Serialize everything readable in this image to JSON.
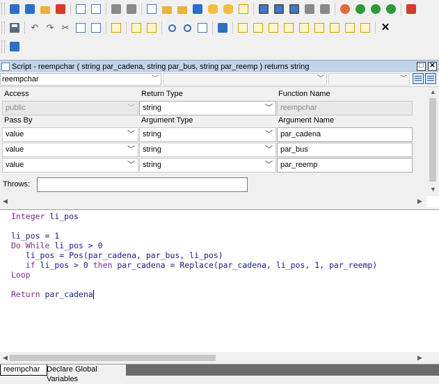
{
  "toolbar3": {
    "icon": "datawindow-icon"
  },
  "window": {
    "title": "Script - reempchar ( string par_cadena, string par_bus, string par_reemp )  returns string"
  },
  "selectors": {
    "function_combo": "reempchar",
    "event_combo": "",
    "object_combo": ""
  },
  "props": {
    "access_label": "Access",
    "return_type_label": "Return Type",
    "function_name_label": "Function Name",
    "access_value": "public",
    "return_type_value": "string",
    "function_name_value": "reempchar",
    "pass_by_label": "Pass By",
    "argument_type_label": "Argument Type",
    "argument_name_label": "Argument Name",
    "arguments": [
      {
        "pass_by": "value",
        "type": "string",
        "name": "par_cadena"
      },
      {
        "pass_by": "value",
        "type": "string",
        "name": "par_bus"
      },
      {
        "pass_by": "value",
        "type": "string",
        "name": "par_reemp"
      }
    ],
    "throws_label": "Throws:",
    "throws_value": ""
  },
  "code": {
    "line1_kw": "Integer",
    "line1_txt": " li_pos",
    "line3_txt": "li_pos = 1",
    "line4_kw": "Do While",
    "line4_txt": " li_pos > 0",
    "line5_txt": "   li_pos = Pos(par_cadena, par_bus, li_pos)",
    "line6_kw": "   if",
    "line6_txt1": " li_pos > 0 ",
    "line6_kw2": "then",
    "line6_txt2": " par_cadena = Replace(par_cadena, li_pos, 1, par_reemp)",
    "line7_kw": "Loop",
    "line9_kw": "Return",
    "line9_txt": " par_cadena"
  },
  "tabs": [
    "reempchar",
    "Declare Global Variables"
  ]
}
